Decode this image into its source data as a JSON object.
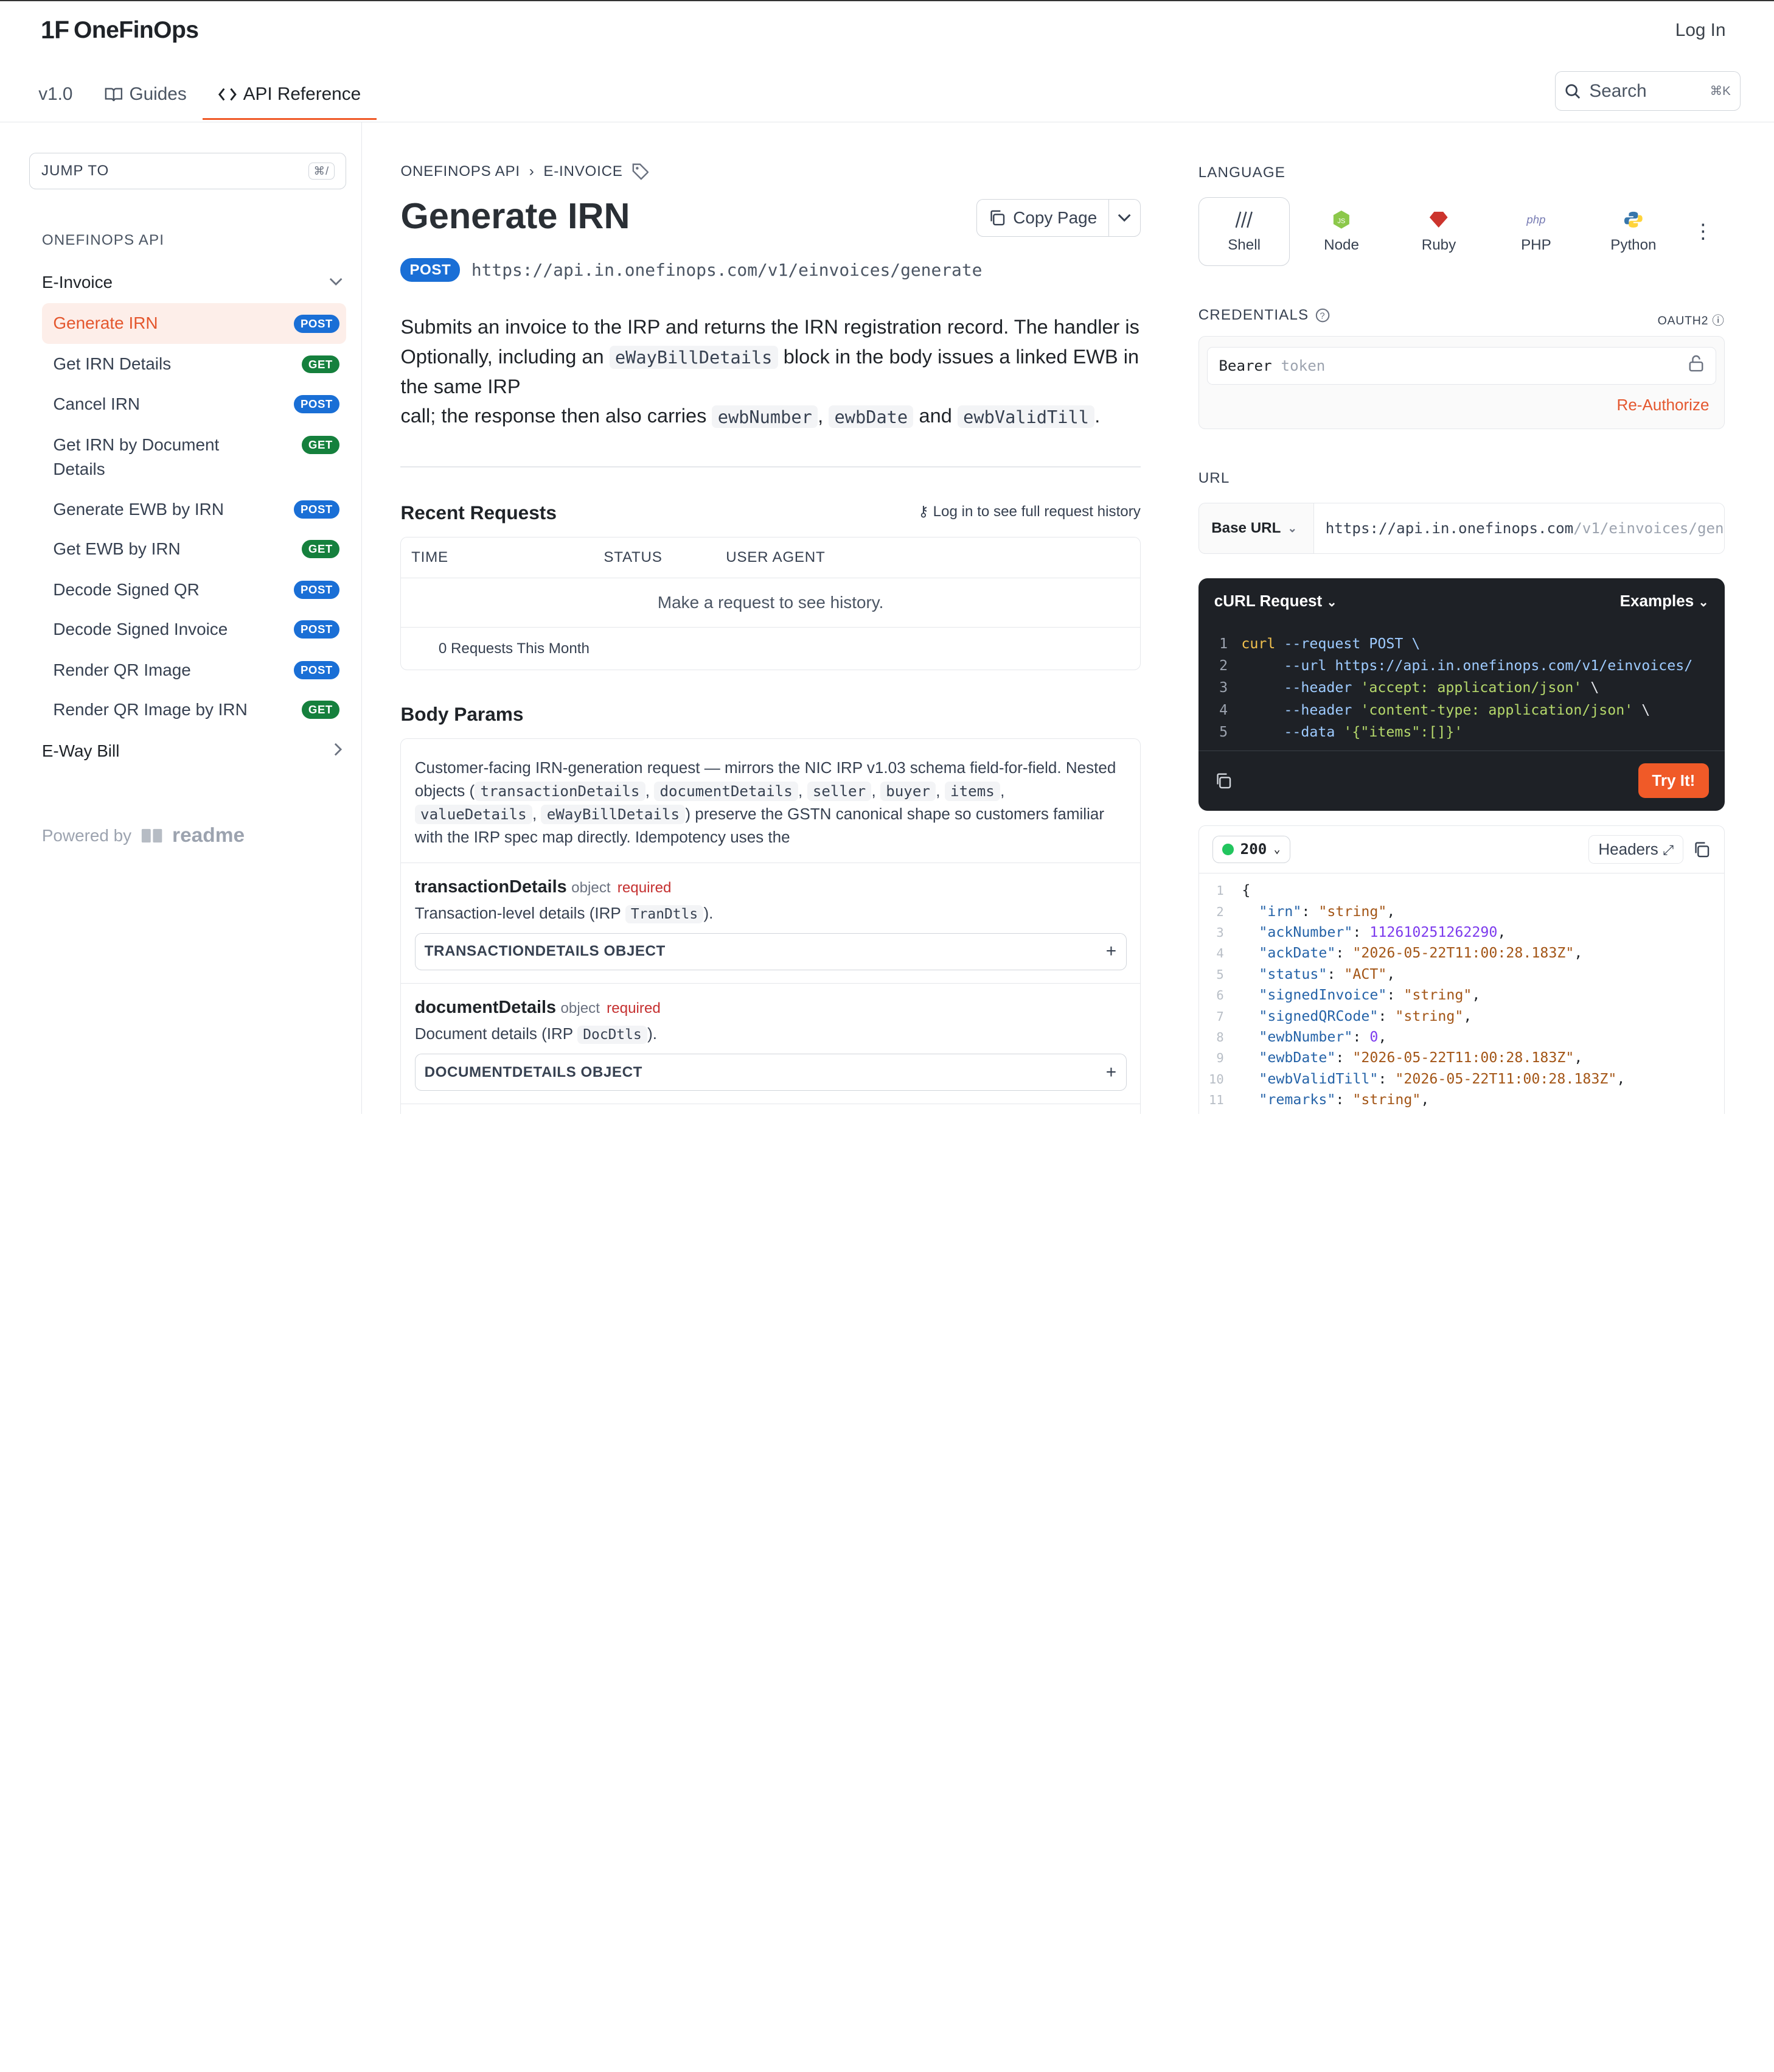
{
  "brand": {
    "name": "OneFinOps",
    "logo_mark": "1F"
  },
  "header": {
    "login": "Log In",
    "version": "v1.0",
    "tabs": [
      {
        "label": "Guides"
      },
      {
        "label": "API Reference"
      }
    ],
    "search_placeholder": "Search",
    "search_shortcut": "⌘K"
  },
  "sidebar": {
    "jump_label": "JUMP TO",
    "jump_shortcut": "⌘/",
    "section": "ONEFINOPS API",
    "group1": "E-Invoice",
    "items": [
      {
        "label": "Generate IRN",
        "method": "POST"
      },
      {
        "label": "Get IRN Details",
        "method": "GET"
      },
      {
        "label": "Cancel IRN",
        "method": "POST"
      },
      {
        "label": "Get IRN by Document Details",
        "method": "GET"
      },
      {
        "label": "Generate EWB by IRN",
        "method": "POST"
      },
      {
        "label": "Get EWB by IRN",
        "method": "GET"
      },
      {
        "label": "Decode Signed QR",
        "method": "POST"
      },
      {
        "label": "Decode Signed Invoice",
        "method": "POST"
      },
      {
        "label": "Render QR Image",
        "method": "POST"
      },
      {
        "label": "Render QR Image by IRN",
        "method": "GET"
      }
    ],
    "group2": "E-Way Bill",
    "powered_by": "Powered by",
    "powered_brand": "readme"
  },
  "main": {
    "crumb1": "ONEFINOPS API",
    "crumb2": "E-INVOICE",
    "title": "Generate IRN",
    "copy_page": "Copy Page",
    "method": "POST",
    "url": "https://api.in.onefinops.com/v1/einvoices/generate",
    "desc": {
      "p1": "Submits an invoice to the IRP and returns the IRN registration record. The handler is Optionally, including an ",
      "code1": "eWayBillDetails",
      "p2": " block in the body issues a linked EWB in the same IRP",
      "p3": "call; the response then also carries ",
      "code2": "ewbNumber",
      "sep1": ", ",
      "code3": "ewbDate",
      "sep2": " and ",
      "code4": "ewbValidTill",
      "end": "."
    },
    "recent": {
      "title": "Recent Requests",
      "login_hint": "Log in to see full request history",
      "cols": [
        "TIME",
        "STATUS",
        "USER AGENT"
      ],
      "empty": "Make a request to see history.",
      "footer": "0 Requests This Month"
    },
    "body_params": {
      "title": "Body Params",
      "intro_a": "Customer-facing IRN-generation request — mirrors the NIC IRP v1.03 schema field-for-field. Nested objects (",
      "intro_codes": [
        "transactionDetails",
        "documentDetails",
        "seller",
        "buyer",
        "items",
        "valueDetails",
        "eWayBillDetails"
      ],
      "intro_b": ") preserve the GSTN canonical shape so customers familiar with the IRP spec map directly. Idempotency uses the",
      "params": [
        {
          "name": "transactionDetails",
          "type": "object",
          "req": "required",
          "desc_a": "Transaction-level details (IRP ",
          "desc_code": "TranDtls",
          "desc_b": ").",
          "obj": "TRANSACTIONDETAILS OBJECT"
        },
        {
          "name": "documentDetails",
          "type": "object",
          "req": "required",
          "desc_a": "Document details (IRP ",
          "desc_code": "DocDtls",
          "desc_b": ").",
          "obj": "DOCUMENTDETAILS OBJECT"
        }
      ]
    }
  },
  "right": {
    "language_title": "LANGUAGE",
    "languages": [
      {
        "label": "Shell",
        "icon": "shell-icon"
      },
      {
        "label": "Node",
        "icon": "node-icon"
      },
      {
        "label": "Ruby",
        "icon": "ruby-icon"
      },
      {
        "label": "PHP",
        "icon": "php-icon"
      },
      {
        "label": "Python",
        "icon": "python-icon"
      }
    ],
    "credentials_title": "CREDENTIALS",
    "oauth": "OAUTH2",
    "bearer": "Bearer",
    "token_placeholder": "token",
    "reauthorize": "Re-Authorize",
    "url_title": "URL",
    "base_url": "Base URL",
    "url_host": "https://api.in.onefinops.com",
    "url_path": "/v1/einvoices/gen",
    "code": {
      "title": "cURL Request",
      "examples": "Examples",
      "try": "Try It!",
      "lines": [
        {
          "n": "1",
          "a": "curl",
          "b": " --request POST \\"
        },
        {
          "n": "2",
          "a": "",
          "b": "     --url https://api.in.onefinops.com/v1/einvoices/"
        },
        {
          "n": "3",
          "a": "",
          "b": "     --header ",
          "s": "'accept: application/json'",
          "e": " \\"
        },
        {
          "n": "4",
          "a": "",
          "b": "     --header ",
          "s": "'content-type: application/json'",
          "e": " \\"
        },
        {
          "n": "5",
          "a": "",
          "b": "     --data ",
          "s": "'{\"items\":[]}'",
          "e": ""
        }
      ]
    },
    "response": {
      "status": "200",
      "headers": "Headers",
      "lines": [
        {
          "n": "1",
          "t": "{"
        },
        {
          "n": "2",
          "k": "\"irn\"",
          "v": "\"string\"",
          "vt": "s"
        },
        {
          "n": "3",
          "k": "\"ackNumber\"",
          "v": "112610251262290",
          "vt": "n"
        },
        {
          "n": "4",
          "k": "\"ackDate\"",
          "v": "\"2026-05-22T11:00:28.183Z\"",
          "vt": "s"
        },
        {
          "n": "5",
          "k": "\"status\"",
          "v": "\"ACT\"",
          "vt": "s"
        },
        {
          "n": "6",
          "k": "\"signedInvoice\"",
          "v": "\"string\"",
          "vt": "s"
        },
        {
          "n": "7",
          "k": "\"signedQRCode\"",
          "v": "\"string\"",
          "vt": "s"
        },
        {
          "n": "8",
          "k": "\"ewbNumber\"",
          "v": "0",
          "vt": "n"
        },
        {
          "n": "9",
          "k": "\"ewbDate\"",
          "v": "\"2026-05-22T11:00:28.183Z\"",
          "vt": "s"
        },
        {
          "n": "10",
          "k": "\"ewbValidTill\"",
          "v": "\"2026-05-22T11:00:28.183Z\"",
          "vt": "s"
        },
        {
          "n": "11",
          "k": "\"remarks\"",
          "v": "\"string\"",
          "vt": "s"
        }
      ]
    }
  }
}
